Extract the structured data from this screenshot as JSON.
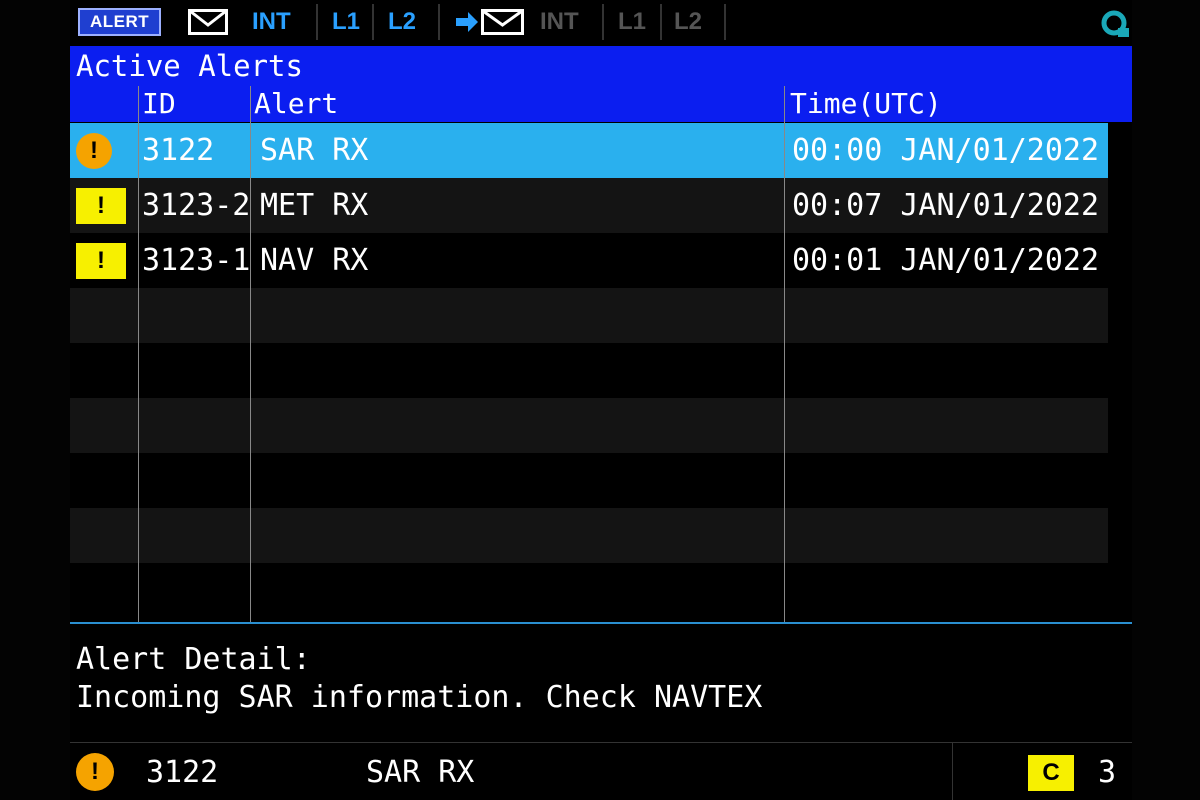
{
  "toolbar": {
    "alert_label": "ALERT",
    "int_label": "INT",
    "l1_label": "L1",
    "l2_label": "L2",
    "tx_int_label": "INT",
    "tx_l1_label": "L1",
    "tx_l2_label": "L2"
  },
  "title": "Active Alerts",
  "table": {
    "headers": {
      "id": "ID",
      "alert": "Alert",
      "time": "Time(UTC)"
    },
    "rows": [
      {
        "icon": "!",
        "id": "3122",
        "alert": "SAR RX",
        "time": "00:00 JAN/01/2022"
      },
      {
        "icon": "!",
        "id": "3123-2",
        "alert": "MET RX",
        "time": "00:07 JAN/01/2022"
      },
      {
        "icon": "!",
        "id": "3123-1",
        "alert": "NAV RX",
        "time": "00:01 JAN/01/2022"
      }
    ]
  },
  "detail": {
    "title": "Alert Detail:",
    "text": "Incoming SAR information. Check NAVTEX"
  },
  "status": {
    "icon": "!",
    "id": "3122",
    "alert": "SAR RX",
    "c_label": "C",
    "count": "3"
  },
  "colors": {
    "header_blue": "#0b1ef0",
    "selected_row": "#2ab0ee",
    "warning_orange": "#f5a300",
    "caution_yellow": "#f7f000",
    "active_cyan": "#2aa0ff"
  }
}
